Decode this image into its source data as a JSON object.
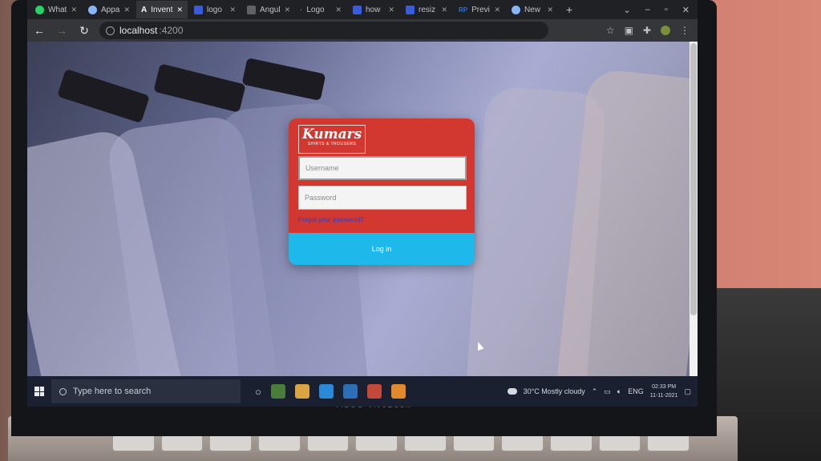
{
  "browser": {
    "tabs": [
      {
        "label": "What",
        "icon": "whatsapp-icon",
        "color": "#25d366"
      },
      {
        "label": "Appa",
        "icon": "globe-icon",
        "color": "#8ab4f8"
      },
      {
        "label": "Invent",
        "icon": "angular-icon",
        "color": "#ffffff",
        "active": true
      },
      {
        "label": "logo",
        "icon": "w-icon",
        "color": "#3b5bdb"
      },
      {
        "label": "Angul",
        "icon": "page-icon",
        "color": "#9aa0a6"
      },
      {
        "label": "Logo",
        "icon": "dot-icon",
        "color": "#9aa0a6"
      },
      {
        "label": "how",
        "icon": "w-icon",
        "color": "#3b5bdb"
      },
      {
        "label": "resiz",
        "icon": "w-icon",
        "color": "#3b5bdb"
      },
      {
        "label": "Previ",
        "icon": "rp-icon",
        "color": "#2f6fd6"
      },
      {
        "label": "New",
        "icon": "globe-icon",
        "color": "#8ab4f8"
      }
    ],
    "address": {
      "host": "localhost",
      "port": ":4200"
    }
  },
  "login": {
    "brand_name": "Kumars",
    "brand_tagline": "SHIRTS & TROUSERS",
    "username_placeholder": "Username",
    "password_placeholder": "Password",
    "forgot_link": "Forgot your password?",
    "login_button": "Log in",
    "colors": {
      "card": "#d2382f",
      "button": "#1fb8ea",
      "link": "#2a40c8"
    }
  },
  "taskbar": {
    "search_placeholder": "Type here to search",
    "weather": "30°C  Mostly cloudy",
    "language": "ENG",
    "time": "02:33 PM",
    "date": "11-11-2021"
  },
  "device": {
    "brand": "ASUS VivoBook"
  }
}
